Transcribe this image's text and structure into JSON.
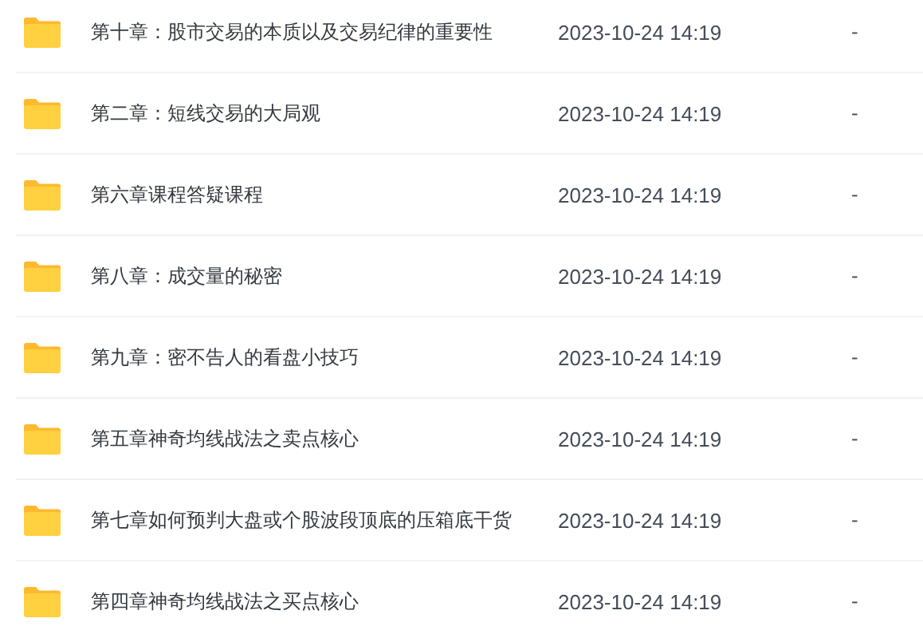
{
  "files": [
    {
      "name": "第十章：股市交易的本质以及交易纪律的重要性",
      "modified": "2023-10-24 14:19",
      "size": "-"
    },
    {
      "name": "第二章：短线交易的大局观",
      "modified": "2023-10-24 14:19",
      "size": "-"
    },
    {
      "name": "第六章课程答疑课程",
      "modified": "2023-10-24 14:19",
      "size": "-"
    },
    {
      "name": "第八章：成交量的秘密",
      "modified": "2023-10-24 14:19",
      "size": "-"
    },
    {
      "name": "第九章：密不告人的看盘小技巧",
      "modified": "2023-10-24 14:19",
      "size": "-"
    },
    {
      "name": "第五章神奇均线战法之卖点核心",
      "modified": "2023-10-24 14:19",
      "size": "-"
    },
    {
      "name": "第七章如何预判大盘或个股波段顶底的压箱底干货",
      "modified": "2023-10-24 14:19",
      "size": "-"
    },
    {
      "name": "第四章神奇均线战法之买点核心",
      "modified": "2023-10-24 14:19",
      "size": "-"
    }
  ]
}
